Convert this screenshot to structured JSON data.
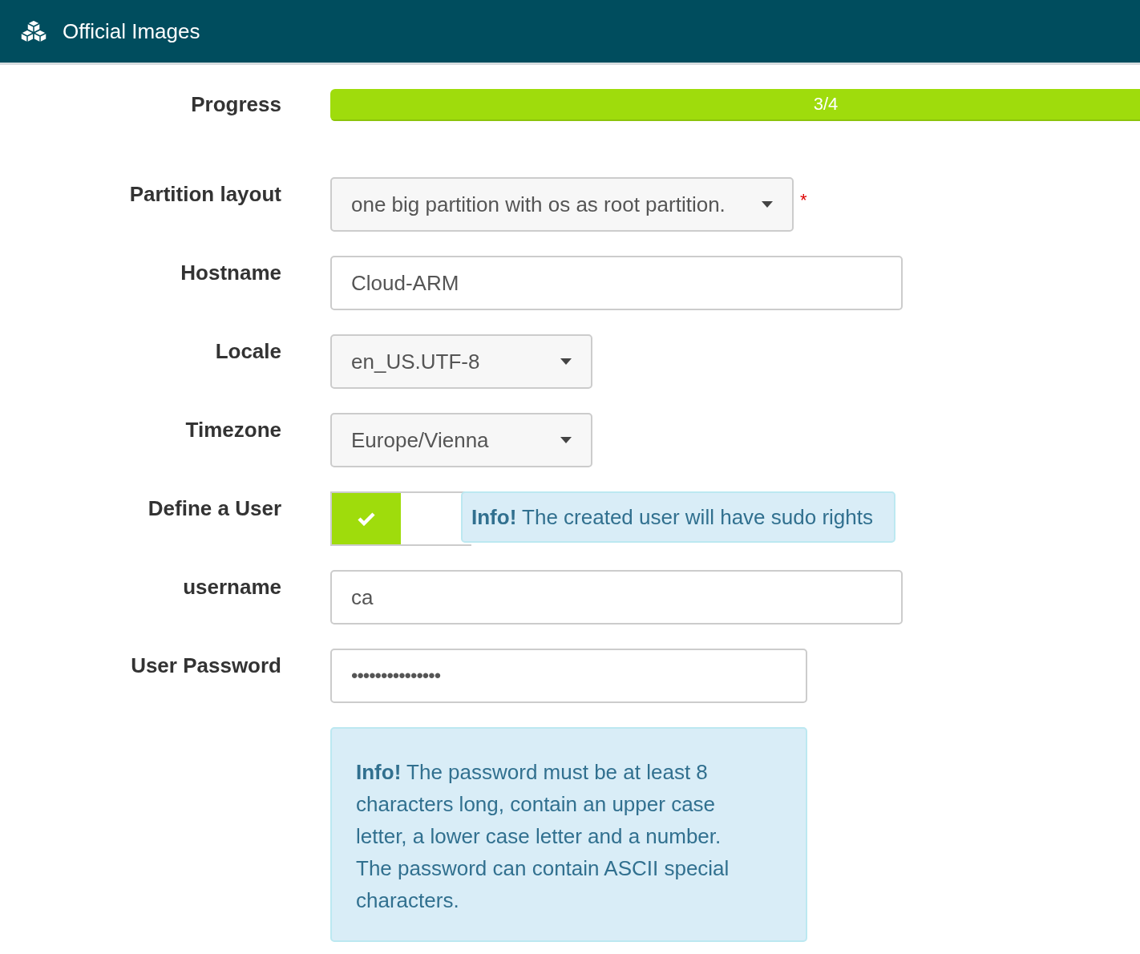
{
  "header": {
    "title": "Official Images"
  },
  "progress": {
    "label": "Progress",
    "text": "3/4"
  },
  "fields": [
    {
      "kind": "select",
      "label": "Partition layout",
      "value": "one big partition with os as root partition.",
      "required_mark": "*"
    },
    {
      "kind": "text",
      "label": "Hostname",
      "value": "Cloud-ARM"
    },
    {
      "kind": "select",
      "label": "Locale",
      "value": "en_US.UTF-8"
    },
    {
      "kind": "select",
      "label": "Timezone",
      "value": "Europe/Vienna"
    },
    {
      "kind": "toggle",
      "label": "Define a User",
      "on": true,
      "info": "**Info!** The created user will have sudo rights"
    },
    {
      "kind": "text",
      "label": "username",
      "value": "ca"
    },
    {
      "kind": "password",
      "label": "User Password",
      "value": "•••••••••••••••"
    }
  ],
  "password_info": "**Info!** The password must be at least 8 characters long, contain an upper case letter, a lower case letter and a number. The password can contain ASCII special characters."
}
